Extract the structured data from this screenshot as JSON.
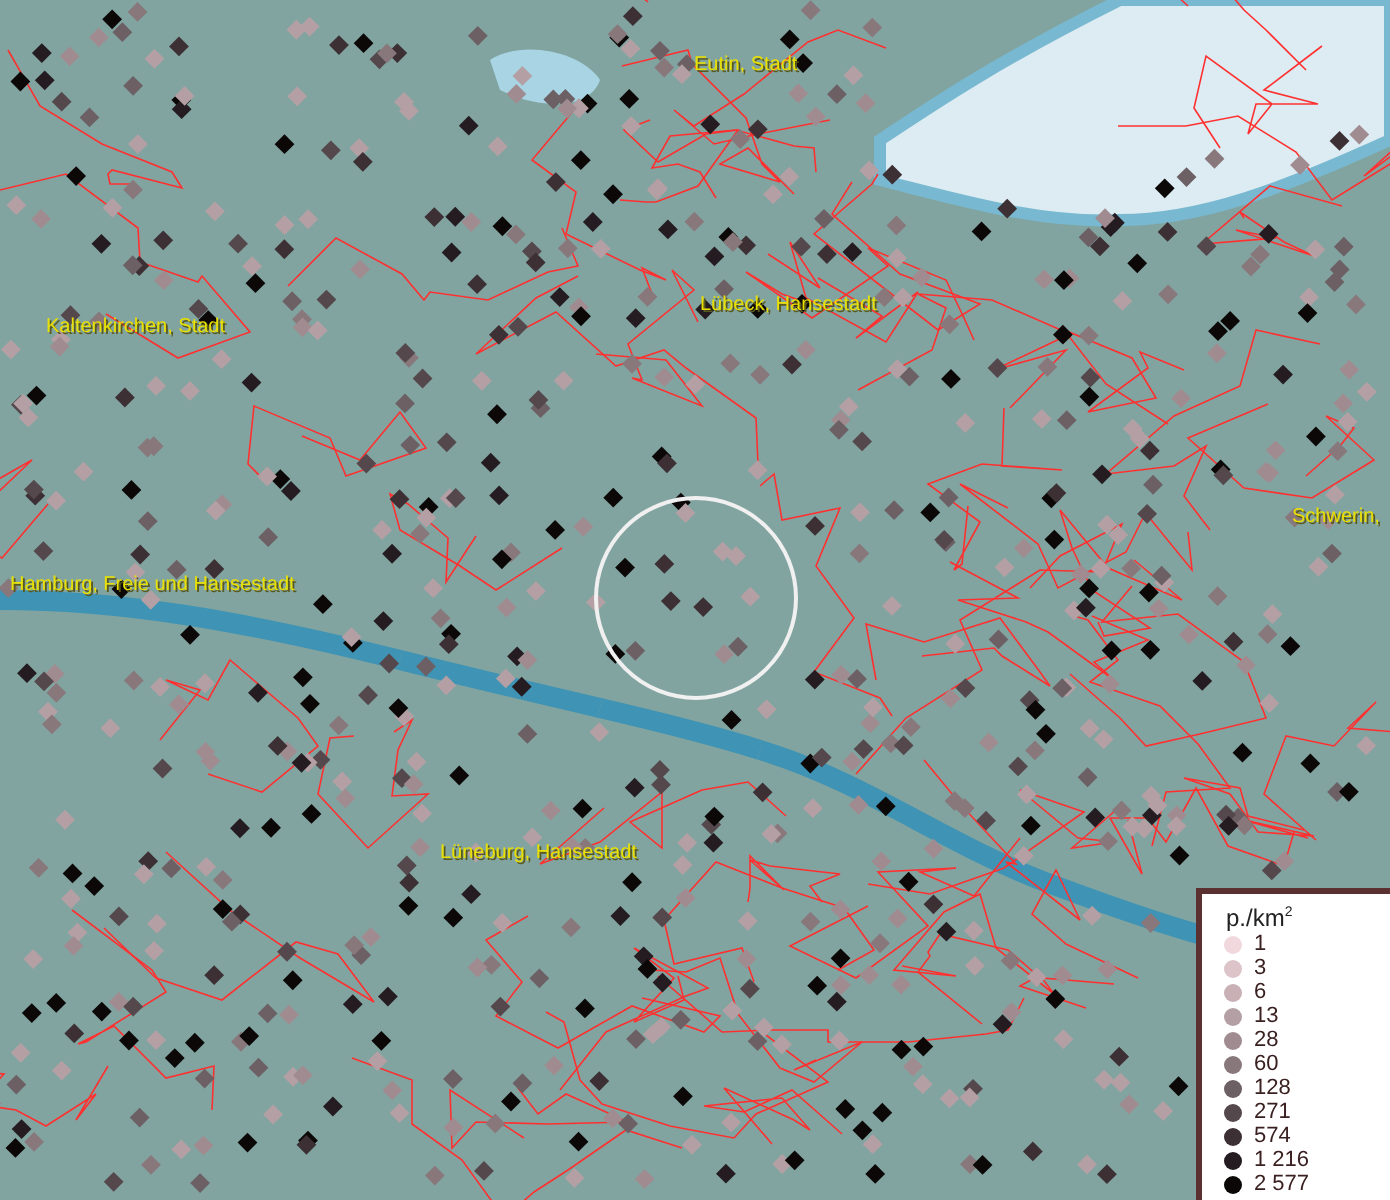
{
  "map": {
    "places": [
      {
        "name": "Eutin, Stadt"
      },
      {
        "name": "Lübeck, Hansestadt"
      },
      {
        "name": "Kaltenkirchen, Stadt"
      },
      {
        "name": "Schwerin,"
      },
      {
        "name": "Hamburg, Freie und Hansestadt"
      },
      {
        "name": "Lüneburg, Hansestadt"
      }
    ]
  },
  "legend": {
    "title": "p./km$^{2}$",
    "items": [
      {
        "label": "1",
        "color": "#f0d8dc"
      },
      {
        "label": "3",
        "color": "#dcc4c8"
      },
      {
        "label": "6",
        "color": "#c8b0b4"
      },
      {
        "label": "13",
        "color": "#b4a0a4"
      },
      {
        "label": "28",
        "color": "#a08c90"
      },
      {
        "label": "60",
        "color": "#88787c"
      },
      {
        "label": "128",
        "color": "#6c6064"
      },
      {
        "label": "271",
        "color": "#54484c"
      },
      {
        "label": "574",
        "color": "#3c3034"
      },
      {
        "label": "1 216",
        "color": "#241c20"
      },
      {
        "label": "2 577",
        "color": "#0c0808"
      }
    ]
  }
}
